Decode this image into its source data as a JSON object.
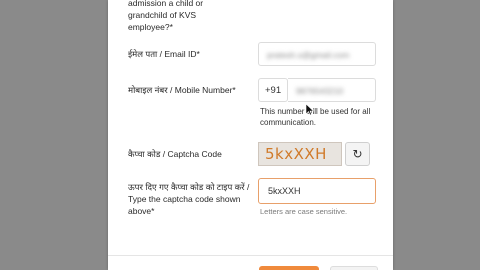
{
  "question_tail": "admission a child or grandchild of KVS employee?*",
  "email": {
    "label": "ईमेल पता / Email ID*",
    "value": "pratesh.s@gmail.com"
  },
  "mobile": {
    "label": "मोबाइल नंबर / Mobile Number*",
    "prefix": "+91",
    "value": "9876543210",
    "note": "This number will be used for all communication."
  },
  "captcha": {
    "label": "कैप्चा कोड / Captcha Code",
    "image_text": "5kxXXH",
    "refresh_icon": "refresh-icon"
  },
  "captcha_input": {
    "label": "ऊपर दिए गए कैप्चा कोड को टाइप करें / Type the captcha code shown above*",
    "value": "5kxXXH",
    "hint": "Letters are case sensitive."
  },
  "colors": {
    "accent": "#f08a3c",
    "captcha_text": "#d07a2a"
  }
}
